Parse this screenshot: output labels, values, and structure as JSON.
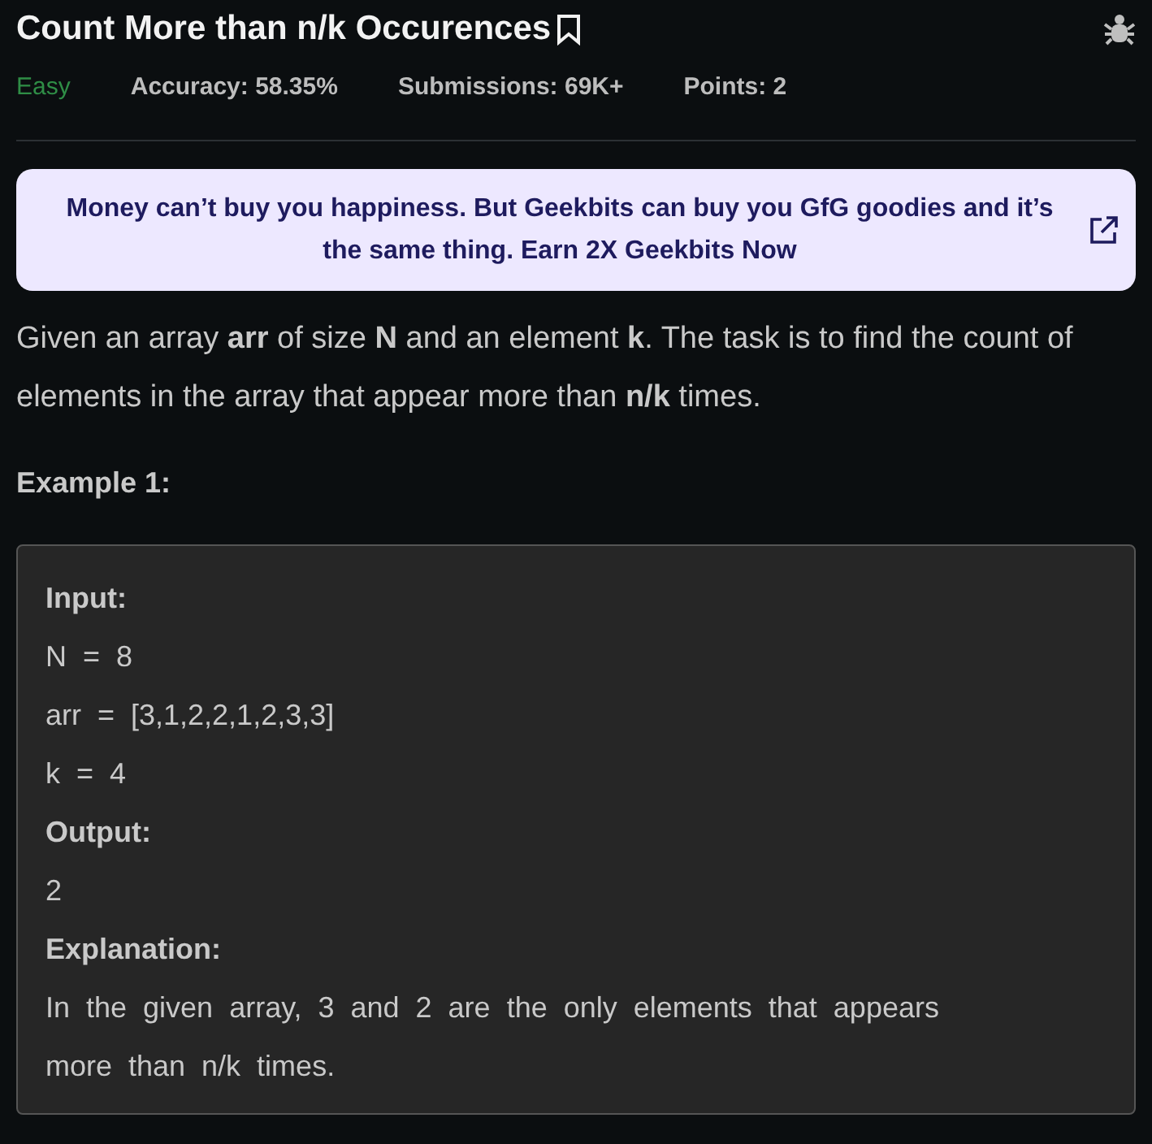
{
  "problem": {
    "title": "Count More than n/k Occurences",
    "bookmarked": false,
    "meta": [
      {
        "kind": "difficulty",
        "text": "Easy"
      },
      {
        "kind": "stat",
        "text": "Accuracy: 58.35%"
      },
      {
        "kind": "stat",
        "text": "Submissions: 69K+"
      },
      {
        "kind": "stat",
        "text": "Points: 2"
      }
    ]
  },
  "banner": {
    "text": "Money can’t buy you happiness. But Geekbits can buy you GfG goodies and it’s the same thing. Earn 2X Geekbits Now"
  },
  "statement": "Given an array **arr** of size **N** and an element **k**. The task is to find the count of elements in the array that appear more than **n/k** times.",
  "example": {
    "heading": "Example 1:",
    "lines": [
      {
        "kind": "label",
        "text": "Input:"
      },
      {
        "kind": "text",
        "text": "N = 8"
      },
      {
        "kind": "text",
        "text": "arr = [3,1,2,2,1,2,3,3]"
      },
      {
        "kind": "text",
        "text": "k = 4"
      },
      {
        "kind": "label",
        "text": "Output:"
      },
      {
        "kind": "text",
        "text": "2"
      },
      {
        "kind": "label",
        "text": "Explanation:"
      },
      {
        "kind": "text",
        "text": "In the given array, 3 and 2 are the only elements that appears more than n/k times."
      }
    ]
  }
}
